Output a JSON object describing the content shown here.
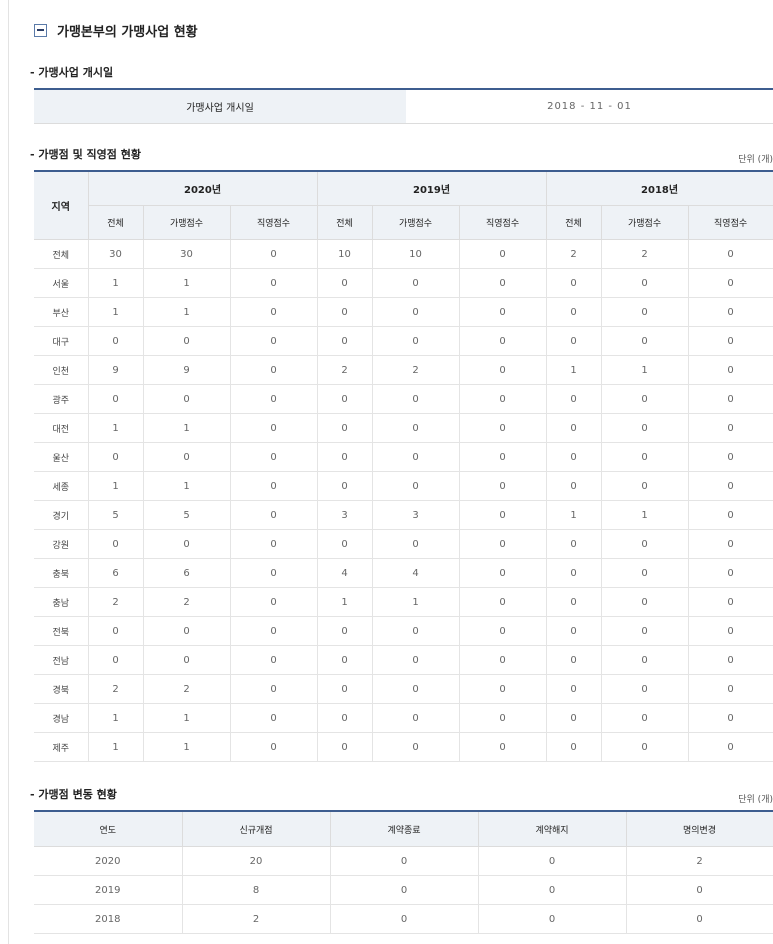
{
  "section": {
    "title": "가맹본부의 가맹사업 현황"
  },
  "start": {
    "heading": "- 가맹사업 개시일",
    "label": "가맹사업 개시일",
    "value": "2018 - 11 - 01"
  },
  "stores": {
    "heading": "- 가맹점 및 직영점 현황",
    "unit": "단위 (개)",
    "region_header": "지역",
    "years": [
      "2020년",
      "2019년",
      "2018년"
    ],
    "col_headers": [
      "전체",
      "가맹점수",
      "직영점수"
    ],
    "rows": [
      {
        "region": "전체",
        "v": [
          "30",
          "30",
          "0",
          "10",
          "10",
          "0",
          "2",
          "2",
          "0"
        ]
      },
      {
        "region": "서울",
        "v": [
          "1",
          "1",
          "0",
          "0",
          "0",
          "0",
          "0",
          "0",
          "0"
        ]
      },
      {
        "region": "부산",
        "v": [
          "1",
          "1",
          "0",
          "0",
          "0",
          "0",
          "0",
          "0",
          "0"
        ]
      },
      {
        "region": "대구",
        "v": [
          "0",
          "0",
          "0",
          "0",
          "0",
          "0",
          "0",
          "0",
          "0"
        ]
      },
      {
        "region": "인천",
        "v": [
          "9",
          "9",
          "0",
          "2",
          "2",
          "0",
          "1",
          "1",
          "0"
        ]
      },
      {
        "region": "광주",
        "v": [
          "0",
          "0",
          "0",
          "0",
          "0",
          "0",
          "0",
          "0",
          "0"
        ]
      },
      {
        "region": "대전",
        "v": [
          "1",
          "1",
          "0",
          "0",
          "0",
          "0",
          "0",
          "0",
          "0"
        ]
      },
      {
        "region": "울산",
        "v": [
          "0",
          "0",
          "0",
          "0",
          "0",
          "0",
          "0",
          "0",
          "0"
        ]
      },
      {
        "region": "세종",
        "v": [
          "1",
          "1",
          "0",
          "0",
          "0",
          "0",
          "0",
          "0",
          "0"
        ]
      },
      {
        "region": "경기",
        "v": [
          "5",
          "5",
          "0",
          "3",
          "3",
          "0",
          "1",
          "1",
          "0"
        ]
      },
      {
        "region": "강원",
        "v": [
          "0",
          "0",
          "0",
          "0",
          "0",
          "0",
          "0",
          "0",
          "0"
        ]
      },
      {
        "region": "충북",
        "v": [
          "6",
          "6",
          "0",
          "4",
          "4",
          "0",
          "0",
          "0",
          "0"
        ]
      },
      {
        "region": "충남",
        "v": [
          "2",
          "2",
          "0",
          "1",
          "1",
          "0",
          "0",
          "0",
          "0"
        ]
      },
      {
        "region": "전북",
        "v": [
          "0",
          "0",
          "0",
          "0",
          "0",
          "0",
          "0",
          "0",
          "0"
        ]
      },
      {
        "region": "전남",
        "v": [
          "0",
          "0",
          "0",
          "0",
          "0",
          "0",
          "0",
          "0",
          "0"
        ]
      },
      {
        "region": "경북",
        "v": [
          "2",
          "2",
          "0",
          "0",
          "0",
          "0",
          "0",
          "0",
          "0"
        ]
      },
      {
        "region": "경남",
        "v": [
          "1",
          "1",
          "0",
          "0",
          "0",
          "0",
          "0",
          "0",
          "0"
        ]
      },
      {
        "region": "제주",
        "v": [
          "1",
          "1",
          "0",
          "0",
          "0",
          "0",
          "0",
          "0",
          "0"
        ]
      }
    ]
  },
  "changes": {
    "heading": "- 가맹점 변동 현황",
    "unit": "단위 (개)",
    "headers": [
      "연도",
      "신규개점",
      "계약종료",
      "계약해지",
      "명의변경"
    ],
    "rows": [
      [
        "2020",
        "20",
        "0",
        "0",
        "2"
      ],
      [
        "2019",
        "8",
        "0",
        "0",
        "0"
      ],
      [
        "2018",
        "2",
        "0",
        "0",
        "0"
      ]
    ]
  }
}
